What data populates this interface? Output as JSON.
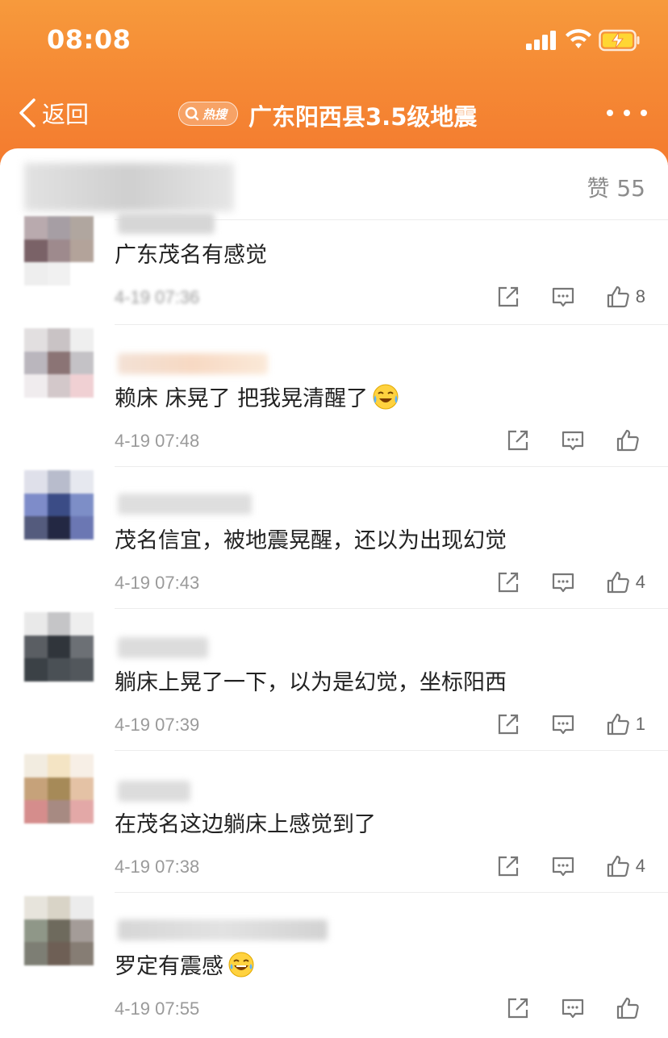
{
  "status_bar": {
    "time": "08:08"
  },
  "nav": {
    "back_label": "返回",
    "hot_badge": "热搜",
    "title": "广东阳西县3.5级地震"
  },
  "top_row": {
    "likes_label": "赞 55"
  },
  "comments": [
    {
      "text": "广东茂名有感觉",
      "time": "4-19 07:36",
      "like_count": "8",
      "emoji": ""
    },
    {
      "text": "赖床 床晃了 把我晃清醒了",
      "time": "4-19 07:48",
      "like_count": "",
      "emoji": "crying-laughing-emoji"
    },
    {
      "text": "茂名信宜，被地震晃醒，还以为出现幻觉",
      "time": "4-19 07:43",
      "like_count": "4",
      "emoji": ""
    },
    {
      "text": "躺床上晃了一下，以为是幻觉，坐标阳西",
      "time": "4-19 07:39",
      "like_count": "1",
      "emoji": ""
    },
    {
      "text": "在茂名这边躺床上感觉到了",
      "time": "4-19 07:38",
      "like_count": "4",
      "emoji": ""
    },
    {
      "text": "罗定有震感",
      "time": "4-19 07:55",
      "like_count": "",
      "emoji": "laughing-tears-emoji"
    }
  ],
  "colors": {
    "header": "#f58a35",
    "text": "#222222",
    "meta": "#9a9a9a"
  }
}
